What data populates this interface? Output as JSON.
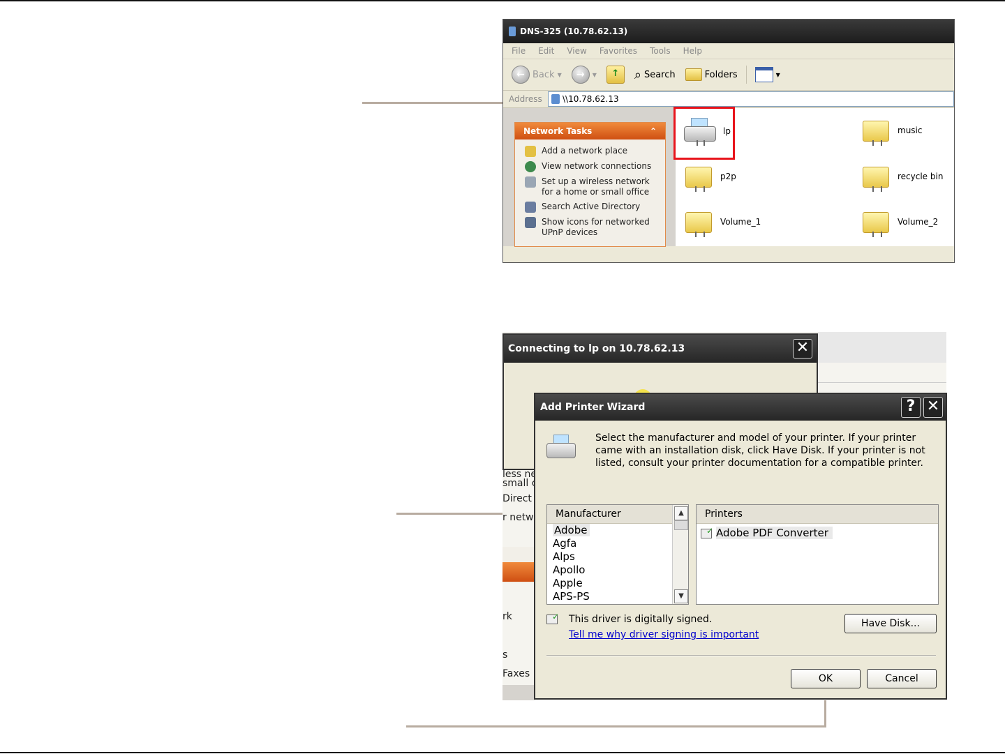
{
  "explorer": {
    "title": "DNS-325 (10.78.62.13)",
    "menu": [
      "File",
      "Edit",
      "View",
      "Favorites",
      "Tools",
      "Help"
    ],
    "toolbar": {
      "back": "Back",
      "search": "Search",
      "folders": "Folders"
    },
    "address_label": "Address",
    "address_value": "\\\\10.78.62.13",
    "network_tasks": {
      "title": "Network Tasks",
      "items": [
        {
          "label": "Add a network place"
        },
        {
          "label": "View network connections"
        },
        {
          "label": "Set up a wireless network for a home or small office"
        },
        {
          "label": "Search Active Directory"
        },
        {
          "label": "Show icons for networked UPnP devices"
        }
      ]
    },
    "files": [
      "lp",
      "music",
      "p2p",
      "recycle bin",
      "Volume_1",
      "Volume_2"
    ]
  },
  "background": {
    "fragments": [
      "less ne",
      "small c",
      "Direct",
      "r netw",
      "rk",
      "s",
      "Faxes"
    ]
  },
  "connecting": {
    "title": "Connecting to lp on 10.78.62.13",
    "close": "✕"
  },
  "wizard": {
    "title": "Add Printer Wizard",
    "help": "?",
    "close": "✕",
    "description": "Select the manufacturer and model of your printer. If your printer came with an installation disk, click Have Disk. If your printer is not listed, consult your printer documentation for a compatible printer.",
    "manufacturer_header": "Manufacturer",
    "manufacturers": [
      "Adobe",
      "Agfa",
      "Alps",
      "Apollo",
      "Apple",
      "APS-PS"
    ],
    "printers_header": "Printers",
    "printers": [
      "Adobe PDF Converter"
    ],
    "signed_text": "This driver is digitally signed.",
    "signing_link": "Tell me why driver signing is important",
    "have_disk": "Have Disk...",
    "ok": "OK",
    "cancel": "Cancel"
  },
  "colors": {
    "highlight": "#e8141c",
    "callout": "#b8aca0",
    "titlebar": "#2a2a2a",
    "task_header": "#e36b23"
  }
}
